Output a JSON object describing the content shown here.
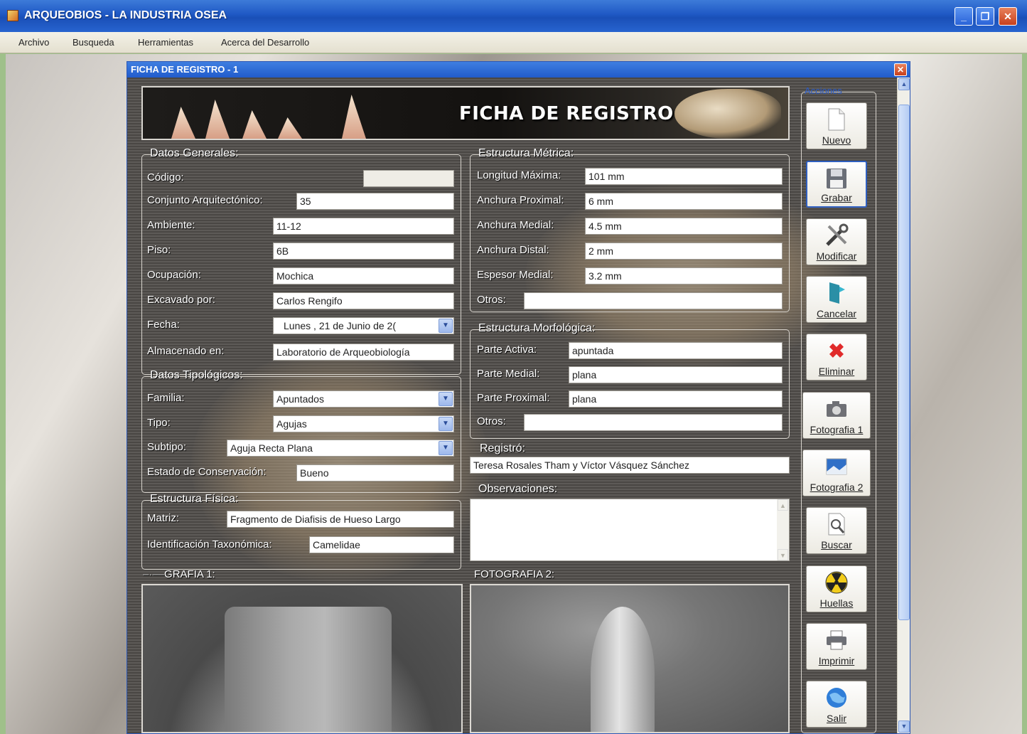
{
  "window": {
    "title": "ARQUEOBIOS - LA INDUSTRIA OSEA"
  },
  "menu": [
    "Archivo",
    "Busqueda",
    "Herramientas",
    "Acerca del Desarrollo"
  ],
  "form": {
    "title": "FICHA DE REGISTRO - 1",
    "banner": "FICHA DE REGISTRO",
    "datos_generales": {
      "legend": "Datos Generales:",
      "codigo_label": "Código:",
      "codigo_value": "",
      "conjunto_label": "Conjunto Arquitectónico:",
      "conjunto_value": "35",
      "ambiente_label": "Ambiente:",
      "ambiente_value": "11-12",
      "piso_label": "Piso:",
      "piso_value": "6B",
      "ocupacion_label": "Ocupación:",
      "ocupacion_value": "Mochica",
      "excavado_label": "Excavado por:",
      "excavado_value": "Carlos Rengifo",
      "fecha_label": "Fecha:",
      "fecha_value": "Lunes  , 21 de    Junio    de 2(",
      "almacenado_label": "Almacenado en:",
      "almacenado_value": "Laboratorio de Arqueobiología"
    },
    "datos_tipologicos": {
      "legend": "Datos Tipológicos:",
      "familia_label": "Familia:",
      "familia_value": "Apuntados",
      "tipo_label": "Tipo:",
      "tipo_value": "Agujas",
      "subtipo_label": "Subtipo:",
      "subtipo_value": "Aguja Recta Plana",
      "estado_label": "Estado de Conservación:",
      "estado_value": "Bueno"
    },
    "estructura_fisica": {
      "legend": "Estructura Física:",
      "matriz_label": "Matriz:",
      "matriz_value": "Fragmento de Diafisis de Hueso Largo",
      "ident_label": "Identificación Taxonómica:",
      "ident_value": "Camelidae"
    },
    "estructura_metrica": {
      "legend": "Estructura Métrica:",
      "longitud_label": "Longitud Máxima:",
      "longitud_value": "101 mm",
      "anch_prox_label": "Anchura Proximal:",
      "anch_prox_value": "6 mm",
      "anch_med_label": "Anchura Medial:",
      "anch_med_value": "4.5 mm",
      "anch_dist_label": "Anchura Distal:",
      "anch_dist_value": "2 mm",
      "espesor_label": "Espesor Medial:",
      "espesor_value": "3.2 mm",
      "otros_label": "Otros:",
      "otros_value": ""
    },
    "estructura_morfologica": {
      "legend": "Estructura Morfológica:",
      "activa_label": "Parte Activa:",
      "activa_value": "apuntada",
      "medial_label": "Parte Medial:",
      "medial_value": "plana",
      "proximal_label": "Parte Proximal:",
      "proximal_value": "plana",
      "otros_label": "Otros:",
      "otros_value": ""
    },
    "registro": {
      "label": "Registró:",
      "value": "Teresa Rosales Tham y Víctor Vásquez Sánchez",
      "obs_label": "Observaciones:",
      "obs_value": ""
    },
    "foto1_label": "GRAFIA 1:",
    "foto2_label": "FOTOGRAFIA 2:"
  },
  "actions": {
    "title": "Acciones",
    "buttons": [
      {
        "label": "Nuevo",
        "icon": "new-document-icon"
      },
      {
        "label": "Grabar",
        "icon": "floppy-disk-icon"
      },
      {
        "label": "Modificar",
        "icon": "tools-icon"
      },
      {
        "label": "Cancelar",
        "icon": "cancel-door-icon"
      },
      {
        "label": "Eliminar",
        "icon": "delete-x-icon"
      },
      {
        "label": "Fotografia 1",
        "icon": "camera-icon"
      },
      {
        "label": "Fotografia 2",
        "icon": "picture-icon"
      },
      {
        "label": "Buscar",
        "icon": "search-document-icon"
      },
      {
        "label": "Huellas",
        "icon": "radiation-icon"
      },
      {
        "label": "Imprimir",
        "icon": "printer-icon"
      },
      {
        "label": "Salir",
        "icon": "globe-exit-icon"
      }
    ]
  }
}
